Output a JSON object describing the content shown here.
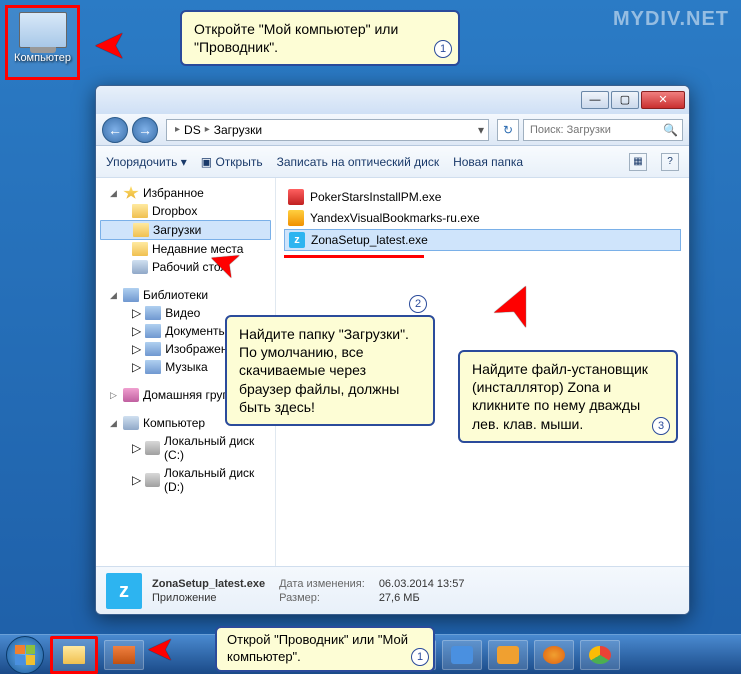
{
  "watermark": "MYDIV.NET",
  "desktop": {
    "computer_label": "Компьютер"
  },
  "callouts": {
    "c1": "Откройте \"Мой компьютер\" или \"Проводник\".",
    "c2": "Найдите папку \"Загрузки\". По умолчанию, все скачиваемые через браузер файлы, должны быть здесь!",
    "c3": "Найдите файл-установщик (инсталлятор) Zona и кликните по нему дважды лев. клав. мыши.",
    "c4": "Открой \"Проводник\" или \"Мой компьютер\".",
    "n1": "1",
    "n2": "2",
    "n3": "3"
  },
  "explorer": {
    "breadcrumbs": {
      "b1": "DS",
      "b2": "Загрузки"
    },
    "search_placeholder": "Поиск: Загрузки",
    "toolbar": {
      "organize": "Упорядочить",
      "open": "Открыть",
      "burn": "Записать на оптический диск",
      "newfolder": "Новая папка"
    },
    "sidebar": {
      "favorites": "Избранное",
      "dropbox": "Dropbox",
      "downloads": "Загрузки",
      "recent": "Недавние места",
      "desktop": "Рабочий стол",
      "libraries": "Библиотеки",
      "video": "Видео",
      "documents": "Документы",
      "pictures": "Изображения",
      "music": "Музыка",
      "homegroup": "Домашняя группа",
      "computer": "Компьютер",
      "diskc": "Локальный диск (C:)",
      "diskd": "Локальный диск (D:)"
    },
    "files": {
      "f1": "PokerStarsInstallPM.exe",
      "f2": "YandexVisualBookmarks-ru.exe",
      "f3": "ZonaSetup_latest.exe"
    },
    "status": {
      "name": "ZonaSetup_latest.exe",
      "type": "Приложение",
      "date_k": "Дата изменения:",
      "date_v": "06.03.2014 13:57",
      "size_k": "Размер:",
      "size_v": "27,6 МБ"
    }
  }
}
